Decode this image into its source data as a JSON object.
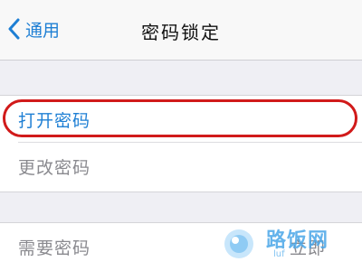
{
  "navbar": {
    "back_label": "通用",
    "back_icon": "chevron-left-icon",
    "title": "密码锁定"
  },
  "settings": {
    "turn_on_passcode": "打开密码",
    "change_passcode": "更改密码",
    "require_passcode": "需要密码",
    "require_passcode_value": "立即"
  },
  "annotation": {
    "highlight_color": "#d11a1a"
  },
  "watermark": {
    "text": "路饭网",
    "subtext": "luf"
  },
  "colors": {
    "accent": "#1e7fd4",
    "background": "#efeff4",
    "muted_text": "#8a8a8f"
  }
}
